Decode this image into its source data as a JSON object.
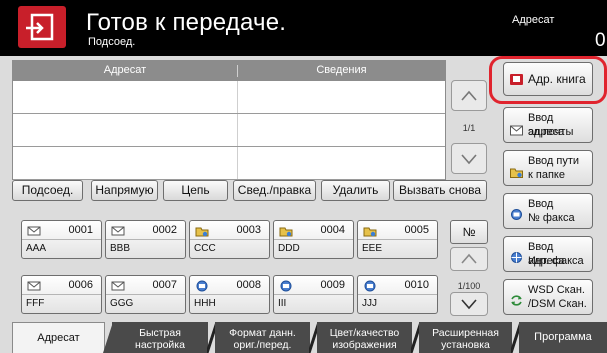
{
  "header": {
    "title": "Готов к передаче.",
    "subtitle": "Подсоед.",
    "destination_label": "Адресат",
    "destination_count": "0"
  },
  "list": {
    "col_destination": "Адресат",
    "col_details": "Сведения",
    "page": "1/1"
  },
  "actions": [
    "Подсоед.",
    "Напрямую",
    "Цепь",
    "Свед./правка",
    "Удалить",
    "Вызвать снова"
  ],
  "contacts": [
    {
      "number": "0001",
      "name": "AAA",
      "icon": "email-icon"
    },
    {
      "number": "0002",
      "name": "BBB",
      "icon": "email-icon"
    },
    {
      "number": "0003",
      "name": "CCC",
      "icon": "folder-icon"
    },
    {
      "number": "0004",
      "name": "DDD",
      "icon": "folder-icon"
    },
    {
      "number": "0005",
      "name": "EEE",
      "icon": "folder-icon"
    },
    {
      "number": "0006",
      "name": "FFF",
      "icon": "email-icon"
    },
    {
      "number": "0007",
      "name": "GGG",
      "icon": "email-icon"
    },
    {
      "number": "0008",
      "name": "HHH",
      "icon": "fax-icon"
    },
    {
      "number": "0009",
      "name": "III",
      "icon": "fax-icon"
    },
    {
      "number": "0010",
      "name": "JJJ",
      "icon": "fax-icon"
    }
  ],
  "contacts_nav": {
    "number_label": "№",
    "page": "1/100"
  },
  "right_panel": {
    "address_book": "Адр. книга",
    "email_entry": [
      "Ввод адреса",
      "эл.почты"
    ],
    "folder_entry": [
      "Ввод пути",
      "к папке"
    ],
    "fax_entry": [
      "Ввод",
      "№ факса"
    ],
    "ifax_entry": [
      "Ввод адреса",
      "Инт. факса"
    ],
    "wsd_scan": [
      "WSD Скан.",
      "/DSM Скан."
    ]
  },
  "tabs": [
    {
      "label": [
        "Адресат"
      ],
      "active": true
    },
    {
      "label": [
        "Быстрая",
        "настройка"
      ],
      "active": false
    },
    {
      "label": [
        "Формат данн.",
        "ориг./перед."
      ],
      "active": false
    },
    {
      "label": [
        "Цвет/качество",
        "изображения"
      ],
      "active": false
    },
    {
      "label": [
        "Расширенная",
        "установка"
      ],
      "active": false
    },
    {
      "label": [
        "Программа"
      ],
      "active": false
    }
  ],
  "colors": {
    "accent": "#c81f2a",
    "highlight": "#e0242e",
    "header": "#000000",
    "tab_dark": "#4a4a4a"
  }
}
